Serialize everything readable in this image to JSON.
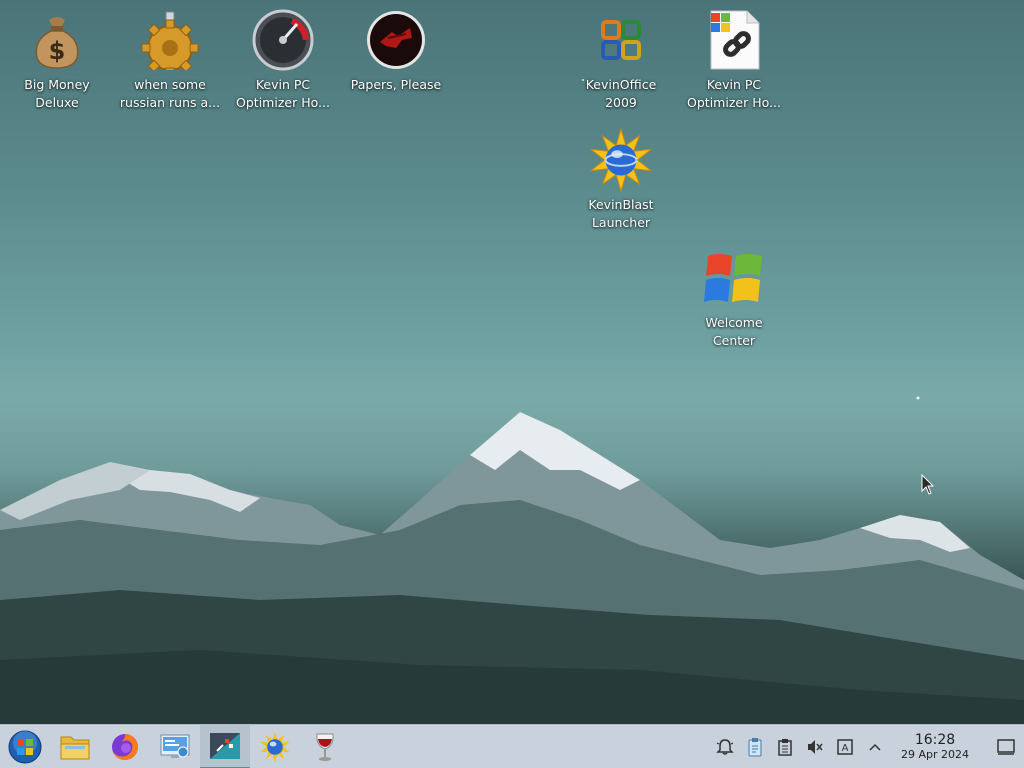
{
  "desktop": {
    "icons": [
      {
        "name": "big-money-deluxe",
        "label": "Big Money\nDeluxe",
        "icon": "money-bag-icon"
      },
      {
        "name": "when-some-russian",
        "label": "when some\nrussian runs a...",
        "icon": "gear-icon"
      },
      {
        "name": "kevin-pc-optimizer-1",
        "label": "Kevin PC\nOptimizer Ho...",
        "icon": "speedometer-icon"
      },
      {
        "name": "papers-please",
        "label": "Papers, Please",
        "icon": "papers-please-icon"
      },
      {
        "name": "kevinoffice-2009",
        "label": "KevinOffice\n2009",
        "icon": "office-icon"
      },
      {
        "name": "kevin-pc-optimizer-2",
        "label": "Kevin PC\nOptimizer Ho...",
        "icon": "shortcut-link-icon"
      },
      {
        "name": "kevinblast-launcher",
        "label": "KevinBlast\nLauncher",
        "icon": "blast-globe-icon"
      },
      {
        "name": "welcome-center",
        "label": "Welcome\nCenter",
        "icon": "windows-logo-icon"
      }
    ]
  },
  "taskbar": {
    "items": [
      "start-orb-icon",
      "file-explorer-icon",
      "firefox-icon",
      "control-panel-icon",
      "terminal-app-icon",
      "kevinblast-icon",
      "wine-glass-icon"
    ],
    "tray": [
      "notifications-icon",
      "clipboard-bin-icon",
      "clipboard-icon",
      "volume-muted-icon",
      "keyboard-layout-icon",
      "chevron-up-icon"
    ],
    "clock": {
      "time": "16:28",
      "date": "29 Apr 2024"
    }
  }
}
